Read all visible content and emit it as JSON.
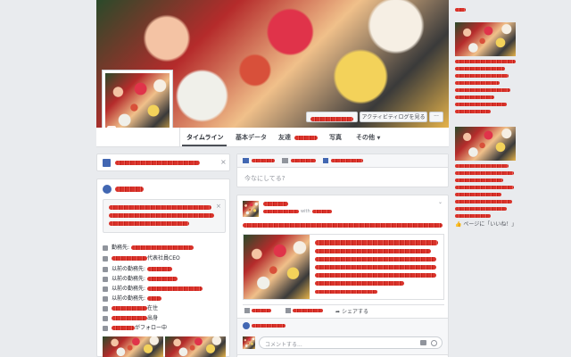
{
  "nav": {
    "tabs": [
      {
        "label": "タイムライン"
      },
      {
        "label": "基本データ"
      },
      {
        "label": "友達"
      },
      {
        "label": "写真"
      },
      {
        "label": "その他"
      }
    ]
  },
  "cover": {
    "activity_button": "アクティビティログを見る",
    "more_button": "···"
  },
  "composer": {
    "placeholder": "今なにしてる?"
  },
  "intro": {
    "rows": [
      {
        "prefix": "勤務先: ",
        "suffix": ""
      },
      {
        "prefix": "",
        "suffix": "代表社員CEO"
      },
      {
        "prefix": "以前の勤務先: ",
        "suffix": ""
      },
      {
        "prefix": "以前の勤務先: ",
        "suffix": ""
      },
      {
        "prefix": "以前の勤務先: ",
        "suffix": ""
      },
      {
        "prefix": "以前の勤務先: ",
        "suffix": ""
      },
      {
        "prefix": "",
        "suffix": "在住"
      },
      {
        "prefix": "",
        "suffix": "出身"
      },
      {
        "prefix": "",
        "suffix": "がフォロー中"
      }
    ]
  },
  "post": {
    "via_text": "with",
    "share_label": "シェアする",
    "comment_placeholder": "コメントする..."
  },
  "right": {
    "page_like": "ページに「いいね！」"
  },
  "colors": {
    "facebook_blue": "#4267b2",
    "background": "#e9ebee",
    "redaction": "#d8322a"
  }
}
